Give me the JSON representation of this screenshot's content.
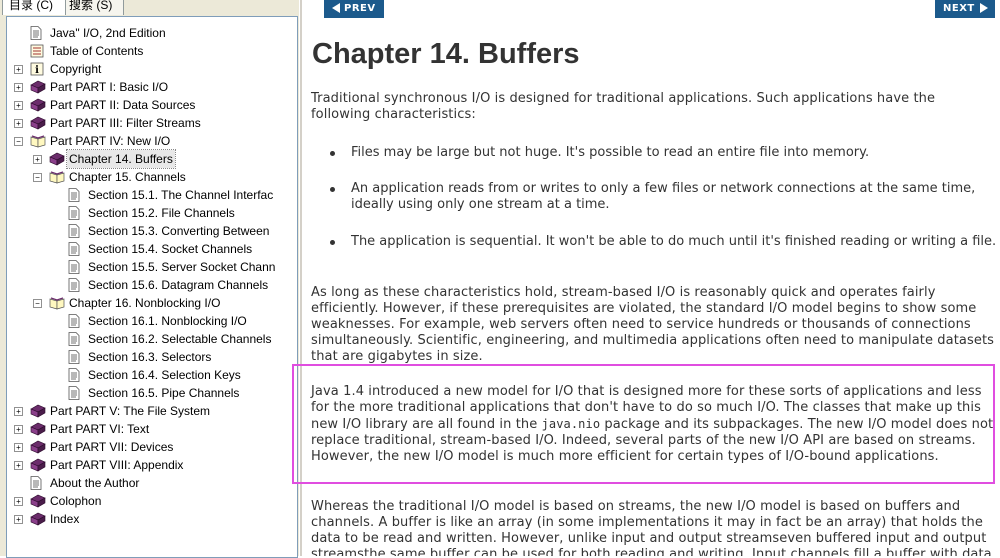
{
  "nav_tabs": {
    "contents_label": "目录 (C)",
    "search_label": "搜索 (S)"
  },
  "tree": [
    {
      "label": "Java\" I/O, 2nd Edition",
      "icon": "page-icon",
      "level": 0,
      "expander": null
    },
    {
      "label": "Table of Contents",
      "icon": "toc-icon",
      "level": 0,
      "expander": null
    },
    {
      "label": "Copyright",
      "icon": "info-icon",
      "level": 0,
      "expander": "+"
    },
    {
      "label": "Part PART I:  Basic I/O",
      "icon": "book-icon",
      "level": 0,
      "expander": "+"
    },
    {
      "label": "Part PART II:  Data Sources",
      "icon": "book-icon",
      "level": 0,
      "expander": "+"
    },
    {
      "label": "Part PART III:  Filter Streams",
      "icon": "book-icon",
      "level": 0,
      "expander": "+"
    },
    {
      "label": "Part PART IV:  New I/O",
      "icon": "book-open-icon",
      "level": 0,
      "expander": "-"
    },
    {
      "label": "Chapter 14.  Buffers",
      "icon": "book-icon",
      "level": 1,
      "expander": "+",
      "selected": true
    },
    {
      "label": "Chapter 15.  Channels",
      "icon": "book-open-icon",
      "level": 1,
      "expander": "-"
    },
    {
      "label": "Section 15.1.  The Channel Interfac",
      "icon": "page-icon",
      "level": 2,
      "expander": null
    },
    {
      "label": "Section 15.2.  File Channels",
      "icon": "page-icon",
      "level": 2,
      "expander": null
    },
    {
      "label": "Section 15.3.  Converting Between",
      "icon": "page-icon",
      "level": 2,
      "expander": null
    },
    {
      "label": "Section 15.4.  Socket Channels",
      "icon": "page-icon",
      "level": 2,
      "expander": null
    },
    {
      "label": "Section 15.5.  Server Socket Chann",
      "icon": "page-icon",
      "level": 2,
      "expander": null
    },
    {
      "label": "Section 15.6.  Datagram Channels",
      "icon": "page-icon",
      "level": 2,
      "expander": null
    },
    {
      "label": "Chapter 16.  Nonblocking I/O",
      "icon": "book-open-icon",
      "level": 1,
      "expander": "-"
    },
    {
      "label": "Section 16.1.  Nonblocking I/O",
      "icon": "page-icon",
      "level": 2,
      "expander": null
    },
    {
      "label": "Section 16.2.  Selectable Channels",
      "icon": "page-icon",
      "level": 2,
      "expander": null
    },
    {
      "label": "Section 16.3.  Selectors",
      "icon": "page-icon",
      "level": 2,
      "expander": null
    },
    {
      "label": "Section 16.4.  Selection Keys",
      "icon": "page-icon",
      "level": 2,
      "expander": null
    },
    {
      "label": "Section 16.5.  Pipe Channels",
      "icon": "page-icon",
      "level": 2,
      "expander": null
    },
    {
      "label": "Part PART V:  The File System",
      "icon": "book-icon",
      "level": 0,
      "expander": "+"
    },
    {
      "label": "Part PART VI:  Text",
      "icon": "book-icon",
      "level": 0,
      "expander": "+"
    },
    {
      "label": "Part PART VII:  Devices",
      "icon": "book-icon",
      "level": 0,
      "expander": "+"
    },
    {
      "label": "Part PART VIII:  Appendix",
      "icon": "book-icon",
      "level": 0,
      "expander": "+"
    },
    {
      "label": "About the Author",
      "icon": "page-icon",
      "level": 0,
      "expander": null
    },
    {
      "label": "Colophon",
      "icon": "book-icon",
      "level": 0,
      "expander": "+"
    },
    {
      "label": "Index",
      "icon": "book-icon",
      "level": 0,
      "expander": "+"
    }
  ],
  "toolbar": {
    "prev_label": "PREV",
    "next_label": "NEXT"
  },
  "content": {
    "title": "Chapter 14. Buffers",
    "intro": "Traditional synchronous I/O is designed for traditional applications. Such applications have the following characteristics:",
    "bullets": [
      "Files may be large but not huge. It's possible to read an entire file into memory.",
      "An application reads from or writes to only a few files or network connections at the same time, ideally using only one stream at a time.",
      "The application is sequential. It won't be able to do much until it's finished reading or writing a file."
    ],
    "para2": "As long as these characteristics hold, stream-based I/O is reasonably quick and operates fairly efficiently. However, if these prerequisites are violated, the standard I/O model begins to show some weaknesses. For example, web servers often need to service hundreds or thousands of connections simultaneously. Scientific, engineering, and multimedia applications often need to manipulate datasets that are gigabytes in size.",
    "para3_a": "Java 1.4 introduced a new model for I/O that is designed more for these sorts of applications and less for the more traditional applications that don't have to do so much I/O. The classes that make up this new I/O library are all found in the ",
    "para3_code": "java.nio",
    "para3_b": " package and its subpackages. The new I/O model does not replace traditional, stream-based I/O. Indeed, several parts of the new I/O API are based on streams. However, the new I/O model is much more efficient for certain types of I/O-bound applications.",
    "para4": "Whereas the traditional I/O model is based on streams, the new I/O model is based on buffers and channels. A buffer is like an array (in some implementations it may in fact be an array) that holds the data to be read and written. However, unlike input and output streamseven buffered input and output streamsthe same buffer can be used for both reading and writing. Input channels fill a buffer with data"
  },
  "colors": {
    "nav_button": "#1c5a8c",
    "highlight_border": "#e04ee0",
    "book_purple": "#6b2c6b"
  }
}
